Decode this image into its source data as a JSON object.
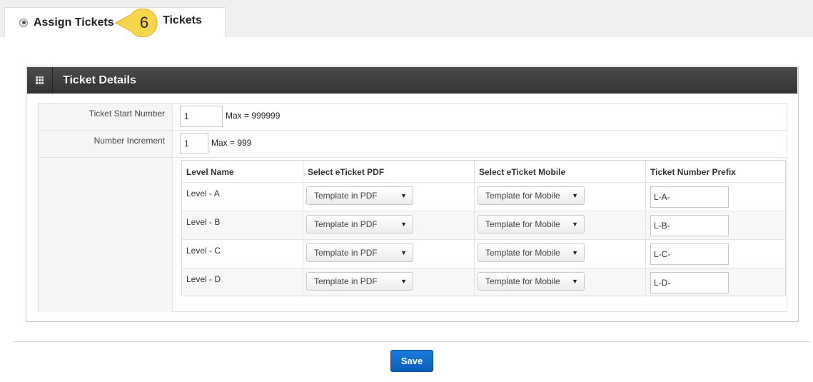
{
  "tabs": {
    "assign_label": "Assign Tickets",
    "second_label": "Tickets"
  },
  "callout": {
    "number": "6"
  },
  "panel": {
    "title": "Ticket Details"
  },
  "form": {
    "start_number": {
      "label": "Ticket Start Number",
      "value": "1",
      "max_note": "Max = 999999"
    },
    "increment": {
      "label": "Number Increment",
      "value": "1",
      "max_note": "Max = 999"
    }
  },
  "levels_table": {
    "headers": [
      "Level Name",
      "Select eTicket PDF",
      "Select eTicket Mobile",
      "Ticket Number Prefix"
    ],
    "rows": [
      {
        "name": "Level - A",
        "pdf": "Template in PDF",
        "mobile": "Template for Mobile",
        "prefix": "L-A-"
      },
      {
        "name": "Level - B",
        "pdf": "Template in PDF",
        "mobile": "Template for Mobile",
        "prefix": "L-B-"
      },
      {
        "name": "Level - C",
        "pdf": "Template in PDF",
        "mobile": "Template for Mobile",
        "prefix": "L-C-"
      },
      {
        "name": "Level - D",
        "pdf": "Template in PDF",
        "mobile": "Template for Mobile",
        "prefix": "L-D-"
      }
    ]
  },
  "actions": {
    "save_label": "Save"
  },
  "colors": {
    "header_bg": "#3d3d3d",
    "save_blue": "#0f6bd0",
    "callout_yellow": "#f5d64a"
  }
}
